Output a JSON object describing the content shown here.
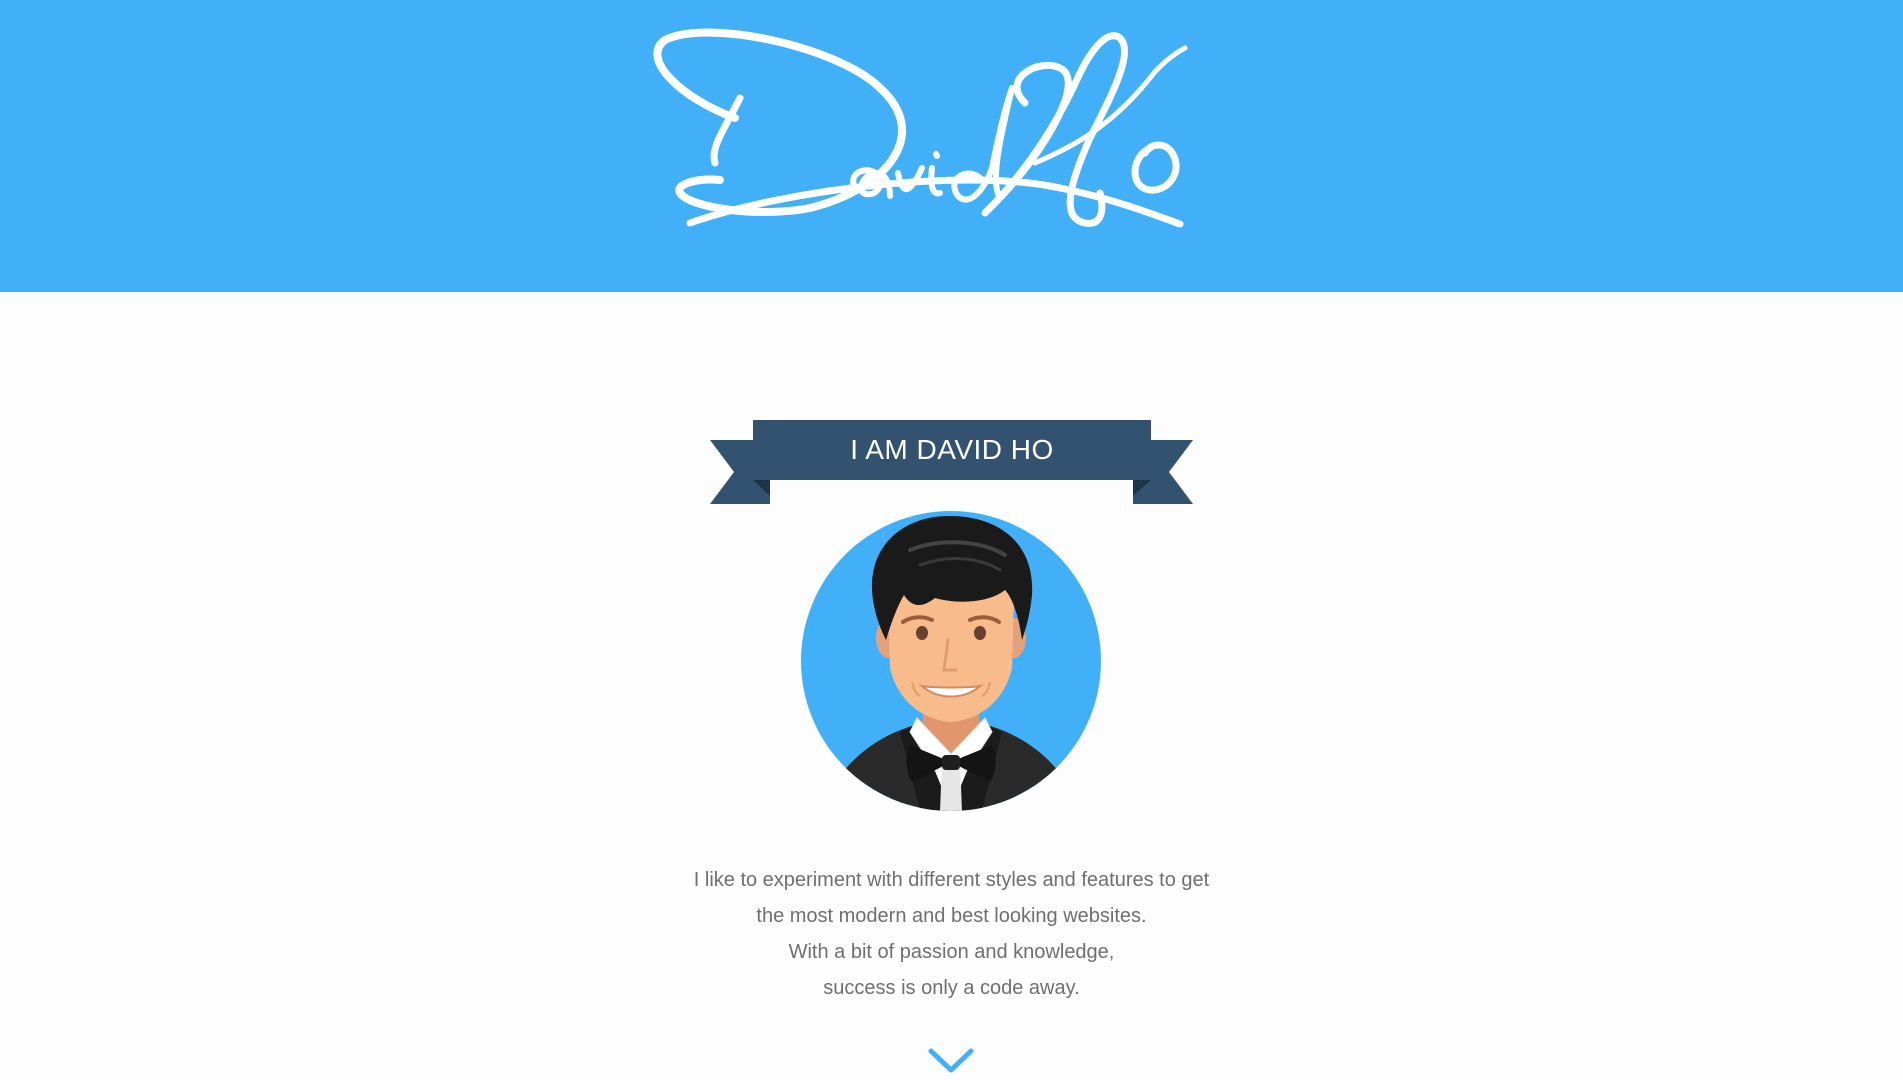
{
  "colors": {
    "header_background": "#42b0f8",
    "page_background": "#fdfdfd",
    "ribbon": "#33526f",
    "ribbon_shadow": "#1f3449",
    "avatar_background": "#42b0f8",
    "bio_text": "#6f6f6f",
    "chevron": "#42b0f8"
  },
  "header": {
    "logo_text": "DavidHo",
    "logo_style": "handwritten signature"
  },
  "ribbon": {
    "label": "I AM DAVID HO"
  },
  "avatar": {
    "icon": "cartoon-man-tuxedo-bowtie"
  },
  "bio": {
    "lines": [
      "I like to experiment with different styles and features to get",
      "the most modern and best looking websites.",
      "With a bit of passion and knowledge,",
      "success is only a code away."
    ]
  },
  "scroll": {
    "icon": "chevron-down-icon"
  }
}
